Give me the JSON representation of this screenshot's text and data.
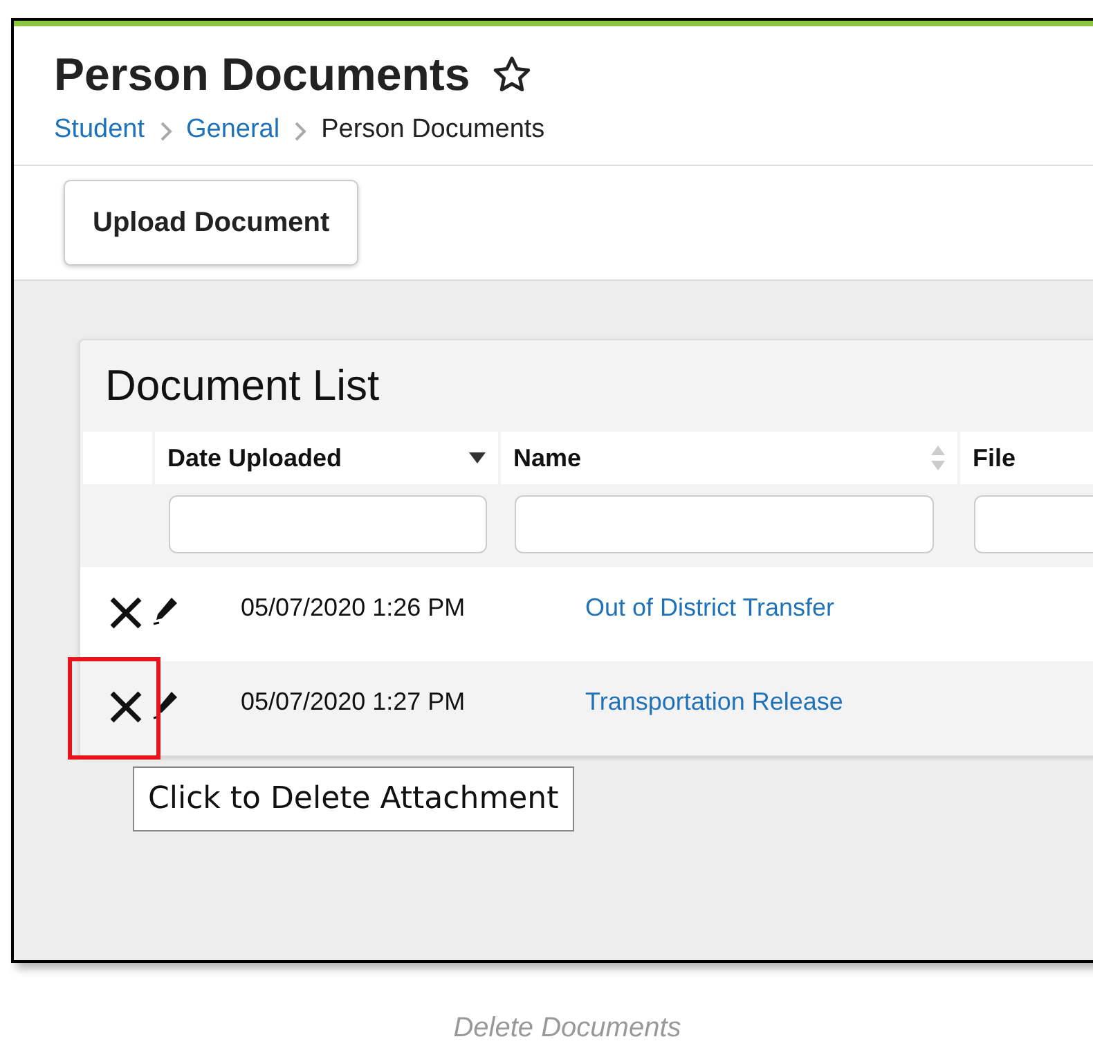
{
  "page": {
    "title": "Person Documents"
  },
  "breadcrumbs": [
    {
      "label": "Student",
      "kind": "link"
    },
    {
      "label": "General",
      "kind": "link"
    },
    {
      "label": "Person Documents",
      "kind": "current"
    }
  ],
  "toolbar": {
    "button": "Upload Document"
  },
  "document_list": {
    "title": "Document List",
    "columns": [
      {
        "label": "Date Uploaded",
        "sorted": true
      },
      {
        "label": "Name",
        "sorted": false
      },
      {
        "label": "File"
      }
    ],
    "rows": [
      {
        "date": "05/07/2020 1:26 PM",
        "name": "Out of District Transfer",
        "highlighted": false
      },
      {
        "date": "05/07/2020 1:27 PM",
        "name": "Transportation Release",
        "highlighted": true
      }
    ]
  },
  "tooltip": "Click to Delete Attachment",
  "caption": "Delete Documents"
}
